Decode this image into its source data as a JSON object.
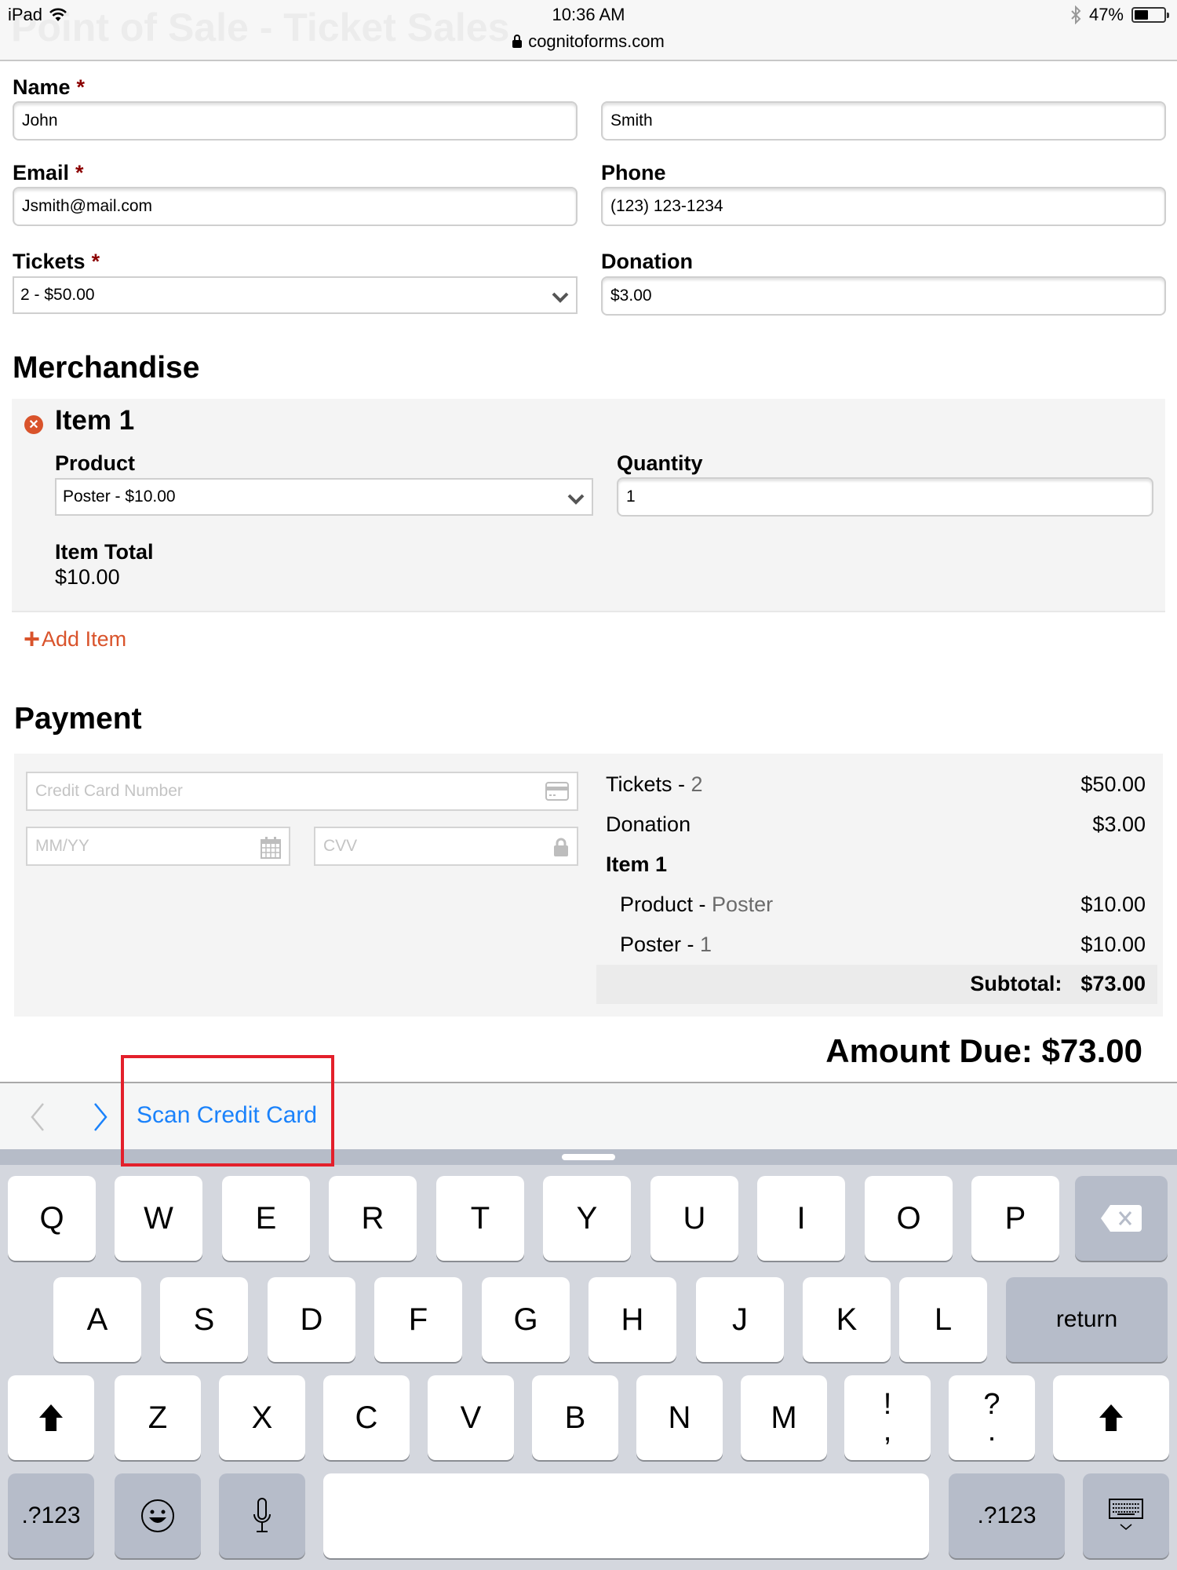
{
  "status_bar": {
    "device": "iPad",
    "time": "10:36 AM",
    "battery_percent_label": "47%",
    "battery_level": 0.47,
    "url": "cognitoforms.com",
    "page_title_ghost": "Point of Sale - Ticket Sales"
  },
  "form": {
    "name": {
      "label": "Name",
      "required_marker": "*",
      "first": "John",
      "last": "Smith"
    },
    "email": {
      "label": "Email",
      "required_marker": "*",
      "value": "Jsmith@mail.com"
    },
    "phone": {
      "label": "Phone",
      "value": "(123) 123-1234"
    },
    "tickets": {
      "label": "Tickets",
      "required_marker": "*",
      "selected": "2 - $50.00"
    },
    "donation": {
      "label": "Donation",
      "value": "$3.00"
    }
  },
  "merchandise": {
    "heading": "Merchandise",
    "items": [
      {
        "title": "Item 1",
        "product_label": "Product",
        "product_selected": "Poster - $10.00",
        "quantity_label": "Quantity",
        "quantity": "1",
        "total_label": "Item Total",
        "total": "$10.00"
      }
    ],
    "add_item_label": "Add Item"
  },
  "payment": {
    "heading": "Payment",
    "card_number_placeholder": "Credit Card Number",
    "expiry_placeholder": "MM/YY",
    "cvv_placeholder": "CVV",
    "summary": {
      "tickets_label": "Tickets - ",
      "tickets_qty": "2",
      "tickets_amount": "$50.00",
      "donation_label": "Donation",
      "donation_amount": "$3.00",
      "item_heading": "Item 1",
      "product_label": "Product - ",
      "product_value": "Poster",
      "product_amount": "$10.00",
      "poster_label": "Poster - ",
      "poster_qty": "1",
      "poster_amount": "$10.00",
      "subtotal_label": "Subtotal:",
      "subtotal_amount": "$73.00"
    },
    "amount_due": "Amount Due: $73.00"
  },
  "accessory_bar": {
    "scan_label": "Scan Credit Card"
  },
  "keyboard": {
    "row1": [
      "Q",
      "W",
      "E",
      "R",
      "T",
      "Y",
      "U",
      "I",
      "O",
      "P"
    ],
    "row2": [
      "A",
      "S",
      "D",
      "F",
      "G",
      "H",
      "J",
      "K",
      "L"
    ],
    "row3": [
      "Z",
      "X",
      "C",
      "V",
      "B",
      "N",
      "M"
    ],
    "return_label": "return",
    "numbers_label": ".?123",
    "punct1_top": "!",
    "punct1_bottom": ",",
    "punct2_top": "?",
    "punct2_bottom": "."
  },
  "colors": {
    "accent_orange": "#d9532b",
    "link_blue": "#1a82fb",
    "required_red": "#8b0000",
    "highlight_red": "#e3202b"
  }
}
